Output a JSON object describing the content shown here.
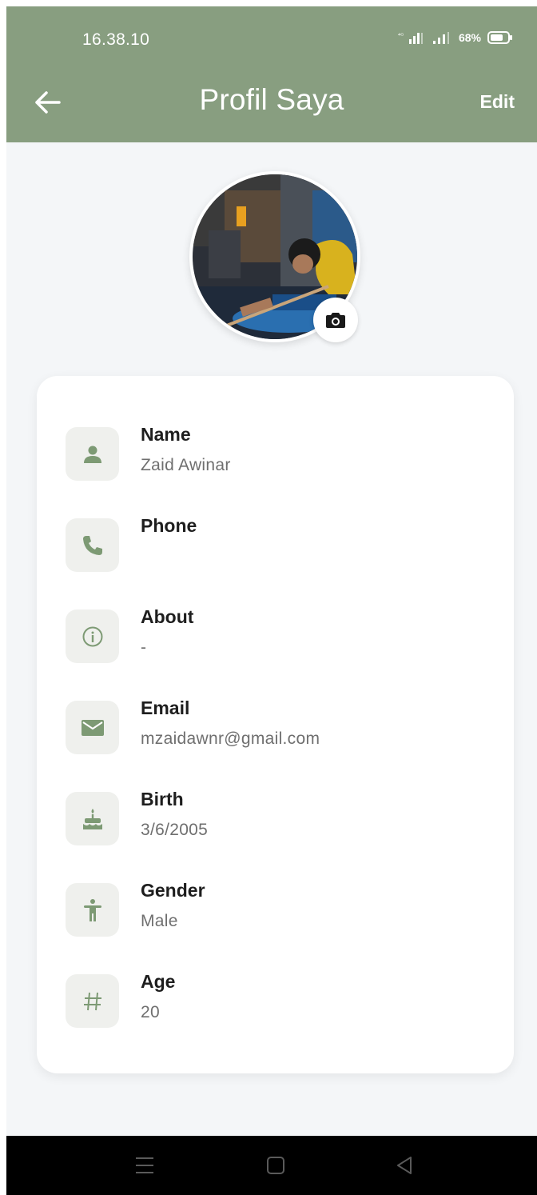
{
  "status_bar": {
    "time": "16.38.10",
    "network": "4G",
    "battery": "68%"
  },
  "app_bar": {
    "title": "Profil Saya",
    "edit_label": "Edit",
    "back_icon": "arrow-left-icon"
  },
  "profile": {
    "avatar_icon": "profile-photo",
    "camera_icon": "camera-icon"
  },
  "fields": [
    {
      "label": "Name",
      "value": "Zaid Awinar",
      "icon": "person-icon"
    },
    {
      "label": "Phone",
      "value": "",
      "icon": "phone-icon"
    },
    {
      "label": "About",
      "value": "-",
      "icon": "info-icon"
    },
    {
      "label": "Email",
      "value": "mzaidawnr@gmail.com",
      "icon": "mail-icon"
    },
    {
      "label": "Birth",
      "value": "3/6/2005",
      "icon": "cake-icon"
    },
    {
      "label": "Gender",
      "value": "Male",
      "icon": "accessibility-icon"
    },
    {
      "label": "Age",
      "value": "20",
      "icon": "hash-icon"
    }
  ],
  "colors": {
    "accent": "#889e80",
    "icon": "#7d9a74",
    "icon_bg": "#eff0ed",
    "background": "#f4f6f8"
  },
  "nav_bar": {
    "menu_icon": "menu-icon",
    "home_icon": "home-square-icon",
    "back_icon": "back-triangle-icon"
  }
}
